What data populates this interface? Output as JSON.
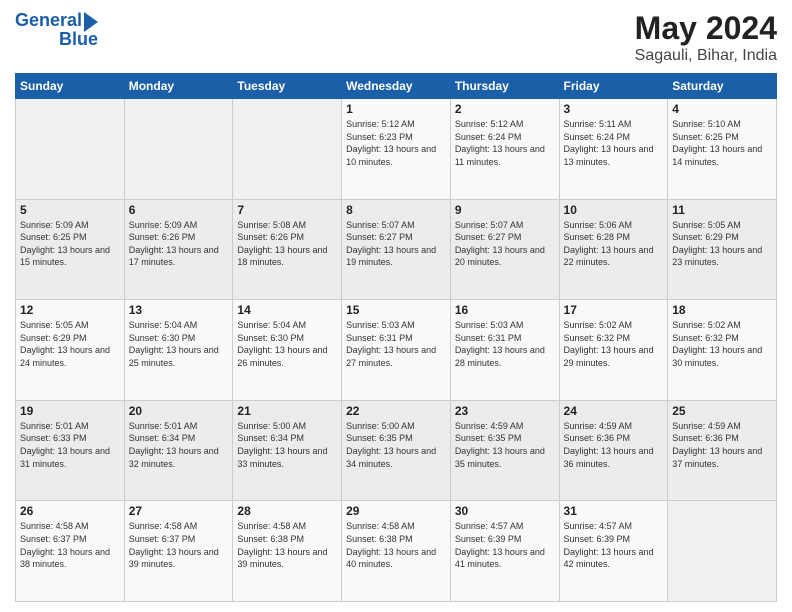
{
  "header": {
    "logo_line1": "General",
    "logo_line2": "Blue",
    "main_title": "May 2024",
    "sub_title": "Sagauli, Bihar, India"
  },
  "weekdays": [
    "Sunday",
    "Monday",
    "Tuesday",
    "Wednesday",
    "Thursday",
    "Friday",
    "Saturday"
  ],
  "weeks": [
    [
      {
        "day": "",
        "sunrise": "",
        "sunset": "",
        "daylight": ""
      },
      {
        "day": "",
        "sunrise": "",
        "sunset": "",
        "daylight": ""
      },
      {
        "day": "",
        "sunrise": "",
        "sunset": "",
        "daylight": ""
      },
      {
        "day": "1",
        "sunrise": "Sunrise: 5:12 AM",
        "sunset": "Sunset: 6:23 PM",
        "daylight": "Daylight: 13 hours and 10 minutes."
      },
      {
        "day": "2",
        "sunrise": "Sunrise: 5:12 AM",
        "sunset": "Sunset: 6:24 PM",
        "daylight": "Daylight: 13 hours and 11 minutes."
      },
      {
        "day": "3",
        "sunrise": "Sunrise: 5:11 AM",
        "sunset": "Sunset: 6:24 PM",
        "daylight": "Daylight: 13 hours and 13 minutes."
      },
      {
        "day": "4",
        "sunrise": "Sunrise: 5:10 AM",
        "sunset": "Sunset: 6:25 PM",
        "daylight": "Daylight: 13 hours and 14 minutes."
      }
    ],
    [
      {
        "day": "5",
        "sunrise": "Sunrise: 5:09 AM",
        "sunset": "Sunset: 6:25 PM",
        "daylight": "Daylight: 13 hours and 15 minutes."
      },
      {
        "day": "6",
        "sunrise": "Sunrise: 5:09 AM",
        "sunset": "Sunset: 6:26 PM",
        "daylight": "Daylight: 13 hours and 17 minutes."
      },
      {
        "day": "7",
        "sunrise": "Sunrise: 5:08 AM",
        "sunset": "Sunset: 6:26 PM",
        "daylight": "Daylight: 13 hours and 18 minutes."
      },
      {
        "day": "8",
        "sunrise": "Sunrise: 5:07 AM",
        "sunset": "Sunset: 6:27 PM",
        "daylight": "Daylight: 13 hours and 19 minutes."
      },
      {
        "day": "9",
        "sunrise": "Sunrise: 5:07 AM",
        "sunset": "Sunset: 6:27 PM",
        "daylight": "Daylight: 13 hours and 20 minutes."
      },
      {
        "day": "10",
        "sunrise": "Sunrise: 5:06 AM",
        "sunset": "Sunset: 6:28 PM",
        "daylight": "Daylight: 13 hours and 22 minutes."
      },
      {
        "day": "11",
        "sunrise": "Sunrise: 5:05 AM",
        "sunset": "Sunset: 6:29 PM",
        "daylight": "Daylight: 13 hours and 23 minutes."
      }
    ],
    [
      {
        "day": "12",
        "sunrise": "Sunrise: 5:05 AM",
        "sunset": "Sunset: 6:29 PM",
        "daylight": "Daylight: 13 hours and 24 minutes."
      },
      {
        "day": "13",
        "sunrise": "Sunrise: 5:04 AM",
        "sunset": "Sunset: 6:30 PM",
        "daylight": "Daylight: 13 hours and 25 minutes."
      },
      {
        "day": "14",
        "sunrise": "Sunrise: 5:04 AM",
        "sunset": "Sunset: 6:30 PM",
        "daylight": "Daylight: 13 hours and 26 minutes."
      },
      {
        "day": "15",
        "sunrise": "Sunrise: 5:03 AM",
        "sunset": "Sunset: 6:31 PM",
        "daylight": "Daylight: 13 hours and 27 minutes."
      },
      {
        "day": "16",
        "sunrise": "Sunrise: 5:03 AM",
        "sunset": "Sunset: 6:31 PM",
        "daylight": "Daylight: 13 hours and 28 minutes."
      },
      {
        "day": "17",
        "sunrise": "Sunrise: 5:02 AM",
        "sunset": "Sunset: 6:32 PM",
        "daylight": "Daylight: 13 hours and 29 minutes."
      },
      {
        "day": "18",
        "sunrise": "Sunrise: 5:02 AM",
        "sunset": "Sunset: 6:32 PM",
        "daylight": "Daylight: 13 hours and 30 minutes."
      }
    ],
    [
      {
        "day": "19",
        "sunrise": "Sunrise: 5:01 AM",
        "sunset": "Sunset: 6:33 PM",
        "daylight": "Daylight: 13 hours and 31 minutes."
      },
      {
        "day": "20",
        "sunrise": "Sunrise: 5:01 AM",
        "sunset": "Sunset: 6:34 PM",
        "daylight": "Daylight: 13 hours and 32 minutes."
      },
      {
        "day": "21",
        "sunrise": "Sunrise: 5:00 AM",
        "sunset": "Sunset: 6:34 PM",
        "daylight": "Daylight: 13 hours and 33 minutes."
      },
      {
        "day": "22",
        "sunrise": "Sunrise: 5:00 AM",
        "sunset": "Sunset: 6:35 PM",
        "daylight": "Daylight: 13 hours and 34 minutes."
      },
      {
        "day": "23",
        "sunrise": "Sunrise: 4:59 AM",
        "sunset": "Sunset: 6:35 PM",
        "daylight": "Daylight: 13 hours and 35 minutes."
      },
      {
        "day": "24",
        "sunrise": "Sunrise: 4:59 AM",
        "sunset": "Sunset: 6:36 PM",
        "daylight": "Daylight: 13 hours and 36 minutes."
      },
      {
        "day": "25",
        "sunrise": "Sunrise: 4:59 AM",
        "sunset": "Sunset: 6:36 PM",
        "daylight": "Daylight: 13 hours and 37 minutes."
      }
    ],
    [
      {
        "day": "26",
        "sunrise": "Sunrise: 4:58 AM",
        "sunset": "Sunset: 6:37 PM",
        "daylight": "Daylight: 13 hours and 38 minutes."
      },
      {
        "day": "27",
        "sunrise": "Sunrise: 4:58 AM",
        "sunset": "Sunset: 6:37 PM",
        "daylight": "Daylight: 13 hours and 39 minutes."
      },
      {
        "day": "28",
        "sunrise": "Sunrise: 4:58 AM",
        "sunset": "Sunset: 6:38 PM",
        "daylight": "Daylight: 13 hours and 39 minutes."
      },
      {
        "day": "29",
        "sunrise": "Sunrise: 4:58 AM",
        "sunset": "Sunset: 6:38 PM",
        "daylight": "Daylight: 13 hours and 40 minutes."
      },
      {
        "day": "30",
        "sunrise": "Sunrise: 4:57 AM",
        "sunset": "Sunset: 6:39 PM",
        "daylight": "Daylight: 13 hours and 41 minutes."
      },
      {
        "day": "31",
        "sunrise": "Sunrise: 4:57 AM",
        "sunset": "Sunset: 6:39 PM",
        "daylight": "Daylight: 13 hours and 42 minutes."
      },
      {
        "day": "",
        "sunrise": "",
        "sunset": "",
        "daylight": ""
      }
    ]
  ]
}
